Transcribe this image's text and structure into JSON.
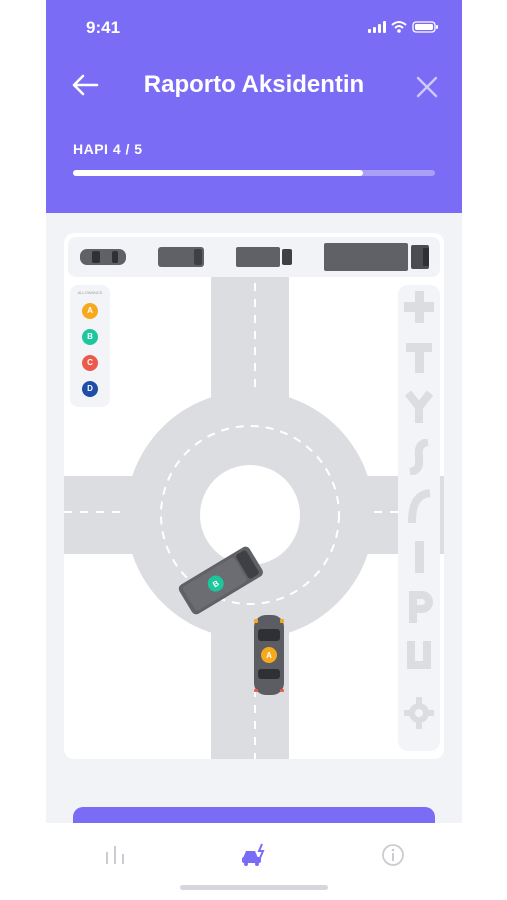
{
  "status_bar": {
    "time": "9:41"
  },
  "header": {
    "title": "Raporto Aksidentin",
    "step_label": "HAPI 4 / 5",
    "progress": 0.8,
    "back_icon": "arrow-left-icon",
    "close_icon": "close-icon"
  },
  "vehicles": [
    {
      "name": "car-vehicle-option"
    },
    {
      "name": "van-vehicle-option"
    },
    {
      "name": "truck-vehicle-option"
    },
    {
      "name": "trailer-truck-vehicle-option"
    }
  ],
  "legend": {
    "title": "ALLOWANCE",
    "items": [
      {
        "label": "A",
        "color": "#f6a91c"
      },
      {
        "label": "B",
        "color": "#1cc79d"
      },
      {
        "label": "C",
        "color": "#ec5a4c"
      },
      {
        "label": "D",
        "color": "#1e4ea8"
      }
    ]
  },
  "road_shapes": [
    "crossroad-shape-icon",
    "t-junction-shape-icon",
    "y-junction-shape-icon",
    "s-curve-shape-icon",
    "curve-shape-icon",
    "straight-road-shape-icon",
    "parking-shape-icon",
    "u-turn-shape-icon",
    "roundabout-shape-icon"
  ],
  "scene": {
    "vehicle_a": {
      "label": "A",
      "type": "car"
    },
    "vehicle_b": {
      "label": "B",
      "type": "van"
    }
  },
  "colors": {
    "accent": "#7b6cf6",
    "road": "#dcdde0",
    "vehicle": "#5f6166"
  },
  "tabs": [
    {
      "name": "stats-tab",
      "icon": "bar-chart-icon",
      "active": false
    },
    {
      "name": "accident-tab",
      "icon": "car-crash-icon",
      "active": true
    },
    {
      "name": "info-tab",
      "icon": "info-icon",
      "active": false
    }
  ]
}
